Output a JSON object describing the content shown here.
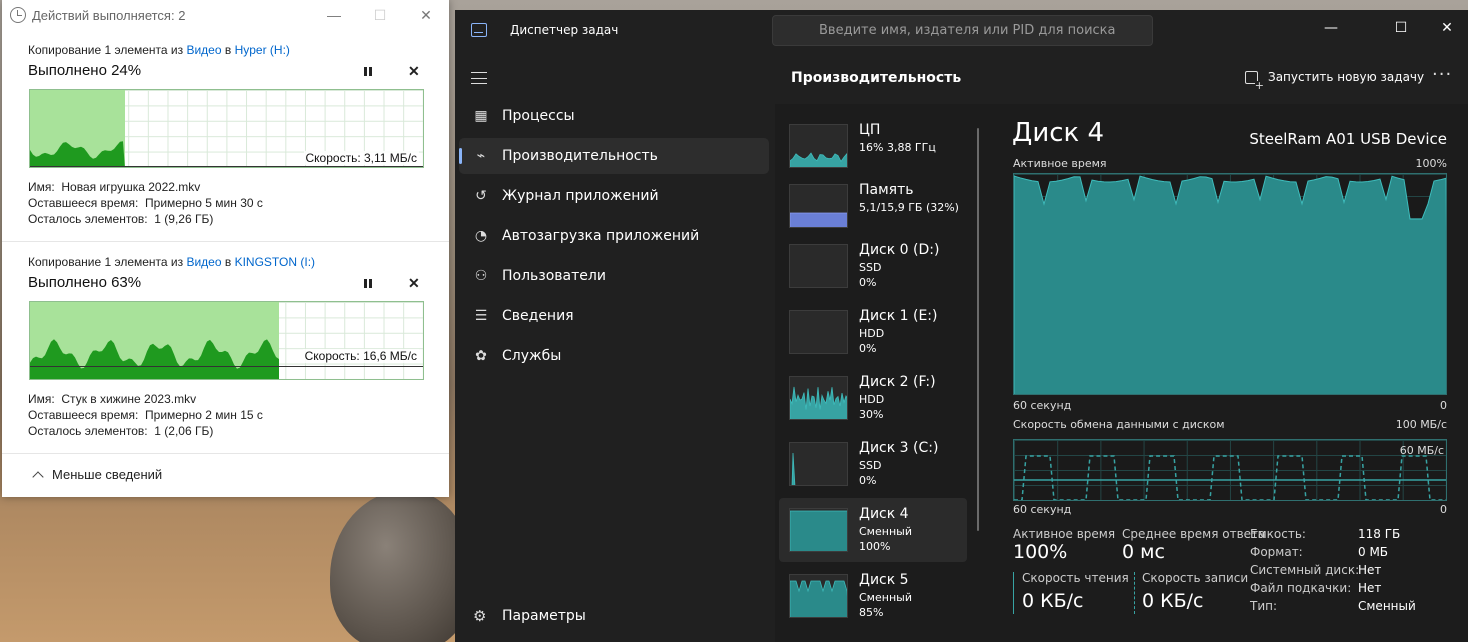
{
  "copy_dialog": {
    "title": "Действий выполняется: 2",
    "operations": [
      {
        "head_prefix": "Копирование 1 элемента из ",
        "source": "Видео",
        "mid": " в ",
        "dest": "Hyper (H:)",
        "percent_label": "Выполнено 24%",
        "progress": 0.24,
        "speed": "Скорость: 3,11 МБ/с",
        "name_label": "Имя:",
        "name_value": "Новая игрушка 2022.mkv",
        "time_label": "Оставшееся время:",
        "time_value": "Примерно 5 мин 30 с",
        "items_label": "Осталось элементов:",
        "items_value": "1 (9,26 ГБ)"
      },
      {
        "head_prefix": "Копирование 1 элемента из ",
        "source": "Видео",
        "mid": " в ",
        "dest": "KINGSTON (I:)",
        "percent_label": "Выполнено 63%",
        "progress": 0.63,
        "speed": "Скорость: 16,6 МБ/с",
        "name_label": "Имя:",
        "name_value": "Стук в хижине 2023.mkv",
        "time_label": "Оставшееся время:",
        "time_value": "Примерно 2 мин 15 с",
        "items_label": "Осталось элементов:",
        "items_value": "1 (2,06 ГБ)"
      }
    ],
    "less_details": "Меньше сведений"
  },
  "taskmgr": {
    "title": "Диспетчер задач",
    "search_placeholder": "Введите имя, издателя или PID для поиска",
    "nav": [
      {
        "label": "Процессы",
        "icon": "processes-icon",
        "active": false
      },
      {
        "label": "Производительность",
        "icon": "performance-icon",
        "active": true
      },
      {
        "label": "Журнал приложений",
        "icon": "history-icon",
        "active": false
      },
      {
        "label": "Автозагрузка приложений",
        "icon": "startup-icon",
        "active": false
      },
      {
        "label": "Пользователи",
        "icon": "users-icon",
        "active": false
      },
      {
        "label": "Сведения",
        "icon": "details-icon",
        "active": false
      },
      {
        "label": "Службы",
        "icon": "services-icon",
        "active": false
      }
    ],
    "settings_label": "Параметры",
    "page_title": "Производительность",
    "run_task": "Запустить новую задачу",
    "perf_items": [
      {
        "name": "ЦП",
        "line2": "16% 3,88 ГГц",
        "line3": ""
      },
      {
        "name": "Память",
        "line2": "5,1/15,9 ГБ (32%)",
        "line3": ""
      },
      {
        "name": "Диск 0 (D:)",
        "line2": "SSD",
        "line3": "0%"
      },
      {
        "name": "Диск 1 (E:)",
        "line2": "HDD",
        "line3": "0%"
      },
      {
        "name": "Диск 2 (F:)",
        "line2": "HDD",
        "line3": "30%"
      },
      {
        "name": "Диск 3 (C:)",
        "line2": "SSD",
        "line3": "0%"
      },
      {
        "name": "Диск 4",
        "line2": "Сменный",
        "line3": "100%"
      },
      {
        "name": "Диск 5",
        "line2": "Сменный",
        "line3": "85%"
      }
    ],
    "detail": {
      "title": "Диск 4",
      "device": "SteelRam A01 USB Device",
      "active_time_label": "Активное время",
      "active_max": "100%",
      "time_span": "60 секунд",
      "zero": "0",
      "transfer_label": "Скорость обмена данными с диском",
      "transfer_max": "100 МБ/с",
      "transfer_mark": "60 МБ/с",
      "stats": {
        "active_time_label": "Активное время",
        "active_time_value": "100%",
        "avg_resp_label": "Среднее время ответа",
        "avg_resp_value": "0 мс",
        "read_label": "Скорость чтения",
        "read_value": "0 КБ/с",
        "write_label": "Скорость записи",
        "write_value": "0 КБ/с"
      },
      "props": [
        {
          "label": "Емкость:",
          "value": "118 ГБ"
        },
        {
          "label": "Формат:",
          "value": "0 МБ"
        },
        {
          "label": "Системный диск:",
          "value": "Нет"
        },
        {
          "label": "Файл подкачки:",
          "value": "Нет"
        },
        {
          "label": "Тип:",
          "value": "Сменный"
        }
      ]
    }
  },
  "colors": {
    "accent": "#8ab4f8",
    "disk_teal": "#37a3a3",
    "copy_green": "#a8e29a"
  }
}
